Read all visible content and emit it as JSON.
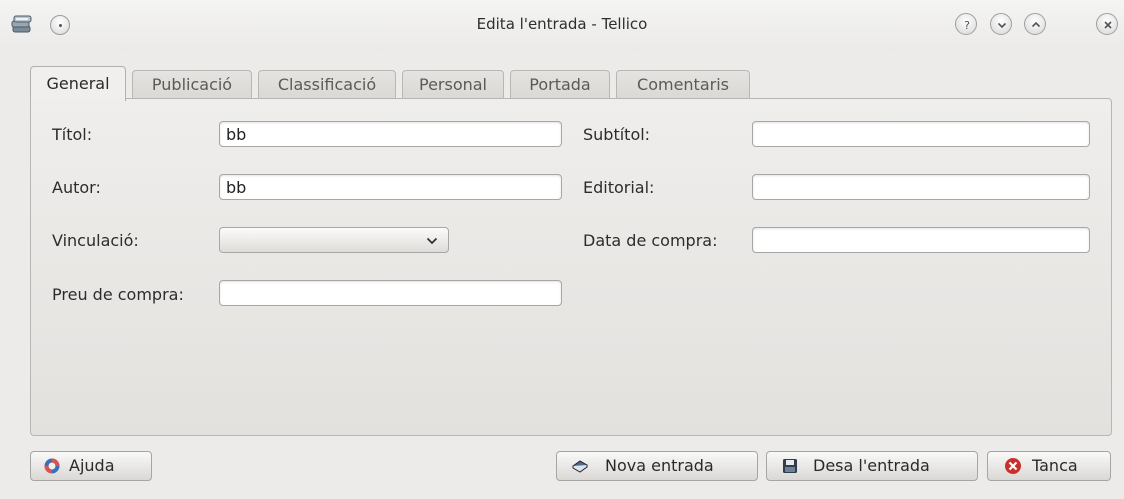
{
  "window": {
    "title": "Edita l'entrada - Tellico"
  },
  "tabs": [
    {
      "label": "General",
      "active": true
    },
    {
      "label": "Publicació",
      "active": false
    },
    {
      "label": "Classificació",
      "active": false
    },
    {
      "label": "Personal",
      "active": false
    },
    {
      "label": "Portada",
      "active": false
    },
    {
      "label": "Comentaris",
      "active": false
    }
  ],
  "form": {
    "titol": {
      "label": "Títol:",
      "value": "bb"
    },
    "subtitol": {
      "label": "Subtítol:",
      "value": ""
    },
    "autor": {
      "label": "Autor:",
      "value": "bb"
    },
    "editorial": {
      "label": "Editorial:",
      "value": ""
    },
    "vinculacio": {
      "label": "Vinculació:",
      "value": ""
    },
    "data_compra": {
      "label": "Data de compra:",
      "value": ""
    },
    "preu_compra": {
      "label": "Preu de compra:",
      "value": ""
    }
  },
  "buttons": {
    "help": "Ajuda",
    "new_entry": "Nova entrada",
    "save_entry": "Desa l'entrada",
    "close": "Tanca"
  },
  "icons": {
    "app": "book-stack-icon",
    "menu": "window-menu-icon",
    "help": "question-icon",
    "minimize": "minimize-icon",
    "maximize": "maximize-icon",
    "close": "close-icon"
  }
}
